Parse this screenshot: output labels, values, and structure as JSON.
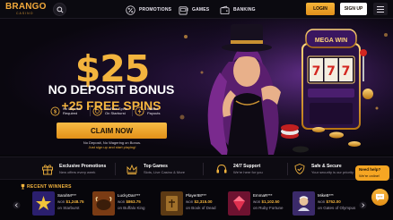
{
  "header": {
    "logo_main": "BRANGO",
    "logo_sub": "CASINO",
    "nav": [
      {
        "label": "PROMOTIONS",
        "icon": "percent-icon"
      },
      {
        "label": "GAMES",
        "icon": "slot-machine-icon"
      },
      {
        "label": "BANKING",
        "icon": "wallet-icon"
      }
    ],
    "login_label": "LOGIN",
    "signup_label": "SIGN UP"
  },
  "hero": {
    "amount": "$25",
    "line1": "NO DEPOSIT BONUS",
    "line2": "+25 FREE SPINS",
    "features": [
      {
        "icon": "no-deposit-icon",
        "text": "No Deposit Required"
      },
      {
        "icon": "free-spins-icon",
        "text": "25 Free Spins On Starburst"
      },
      {
        "icon": "lightning-icon",
        "text": "Instant Payouts"
      }
    ],
    "claim_label": "CLAIM NOW",
    "note_line1": "No Deposit, No Wagering on Bonus.",
    "note_line2": "Just sign up and start playing!",
    "slot_sign": "MEGA WIN",
    "reels": [
      "7",
      "7",
      "7"
    ]
  },
  "info_bar": [
    {
      "icon": "gift-icon",
      "title": "Exclusive Promotions",
      "sub": "New offers every week"
    },
    {
      "icon": "crown-icon",
      "title": "Top Games",
      "sub": "Slots, Live Casino & More"
    },
    {
      "icon": "headset-icon",
      "title": "24/7 Support",
      "sub": "We're here for you"
    },
    {
      "icon": "shield-icon",
      "title": "Safe & Secure",
      "sub": "Your security is our priority"
    }
  ],
  "winners": {
    "title": "RECENT WINNERS",
    "items": [
      {
        "name": "SarahM***",
        "won_prefix": "won",
        "amount": "$1,248.75",
        "game_prefix": "on",
        "game": "Starburst",
        "thumb": "#2b1f6e"
      },
      {
        "name": "LuckyDan***",
        "won_prefix": "won",
        "amount": "$863.75",
        "game_prefix": "on",
        "game": "Buffalo King",
        "thumb": "#7a3b14"
      },
      {
        "name": "Player88***",
        "won_prefix": "won",
        "amount": "$2,315.00",
        "game_prefix": "on",
        "game": "Book of Dead",
        "thumb": "#5c3a14"
      },
      {
        "name": "EmmaR***",
        "won_prefix": "won",
        "amount": "$1,102.50",
        "game_prefix": "on",
        "game": "Ruby Fortune",
        "thumb": "#6e1230"
      },
      {
        "name": "MikeB***",
        "won_prefix": "won",
        "amount": "$752.00",
        "game_prefix": "on",
        "game": "Gates of Olympus",
        "thumb": "#3b2a6a"
      }
    ]
  },
  "help": {
    "title": "Need help?",
    "sub": "We're online!"
  },
  "colors": {
    "accent": "#f3b43e",
    "background": "#07060b"
  }
}
